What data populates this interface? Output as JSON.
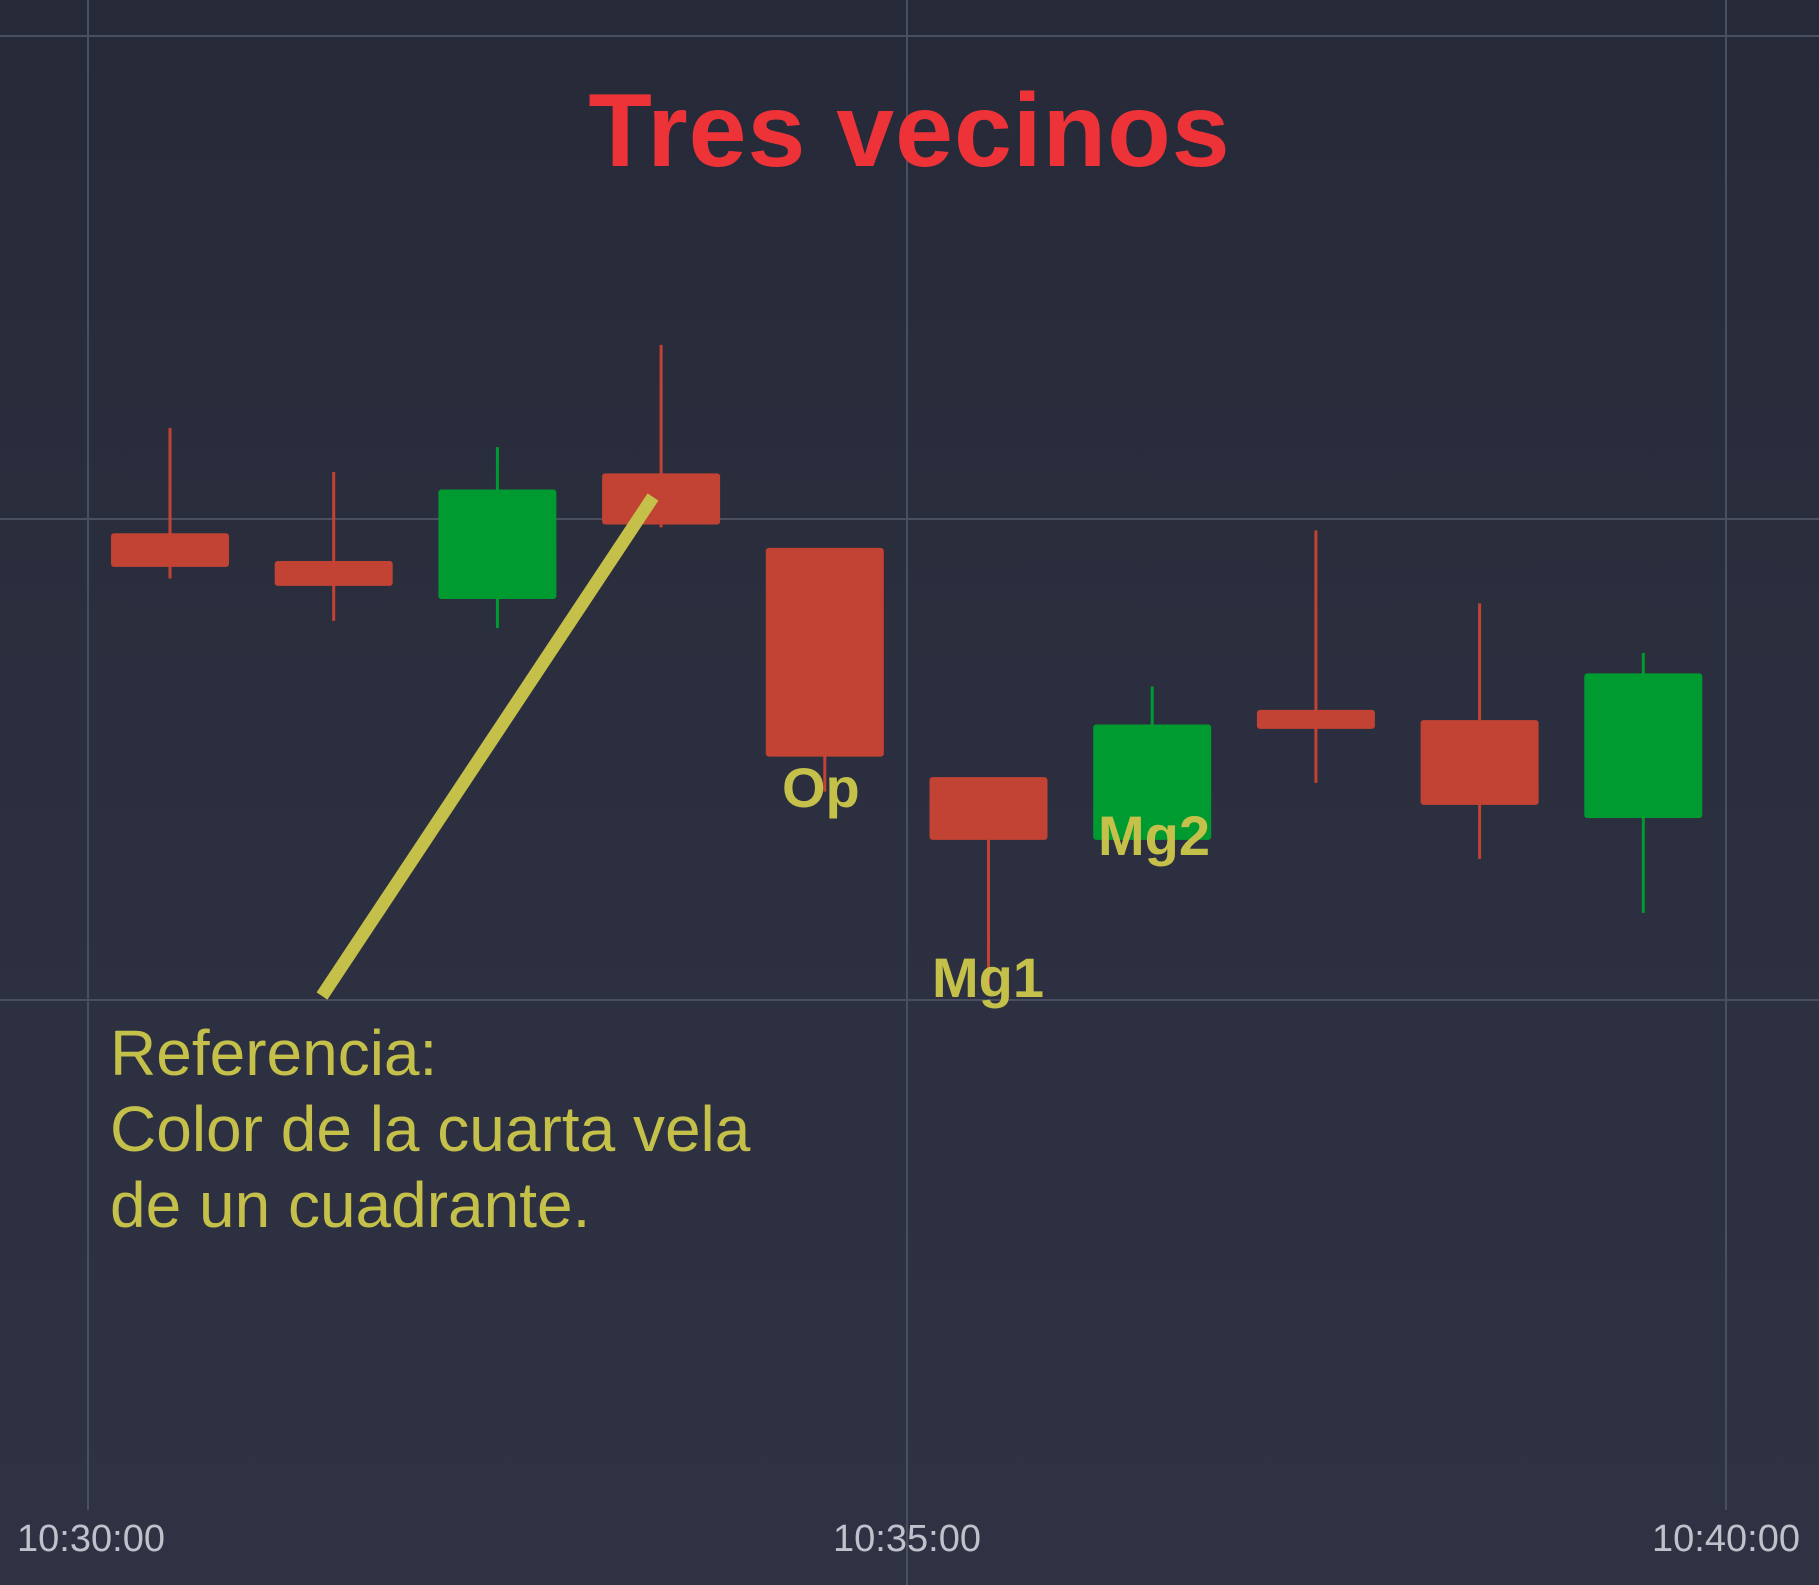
{
  "title": "Tres vecinos",
  "colors": {
    "background": "#2a2e3d",
    "grid": "#4a4f5f",
    "bearish": "#c24333",
    "bullish": "#009b30",
    "title": "#ee3338",
    "annotation": "#c4c049",
    "axis_text": "#bfc2cb"
  },
  "labels": {
    "op": "Op",
    "mg1": "Mg1",
    "mg2": "Mg2",
    "reference_line1": "Referencia:",
    "reference_line2": "Color de la cuarta vela",
    "reference_line3": "de un cuadrante."
  },
  "chart_data": {
    "type": "candlestick",
    "x_tick_labels": [
      "10:30:00",
      "10:35:00",
      "10:40:00"
    ],
    "grid": true,
    "y_range": [
      0,
      100
    ],
    "candles": [
      {
        "open": 66.9,
        "close": 64.6,
        "high": 74.1,
        "low": 63.8
      },
      {
        "open": 65.0,
        "close": 63.3,
        "high": 71.1,
        "low": 60.9
      },
      {
        "open": 62.4,
        "close": 69.9,
        "high": 72.8,
        "low": 60.4
      },
      {
        "open": 71.0,
        "close": 67.5,
        "high": 79.8,
        "low": 67.3
      },
      {
        "open": 65.9,
        "close": 51.6,
        "high": 65.9,
        "low": 49.2
      },
      {
        "open": 50.2,
        "close": 45.9,
        "high": 50.2,
        "low": 35.3
      },
      {
        "open": 45.9,
        "close": 53.8,
        "high": 56.4,
        "low": 45.4
      },
      {
        "open": 54.8,
        "close": 53.5,
        "high": 67.1,
        "low": 49.8
      },
      {
        "open": 54.1,
        "close": 48.3,
        "high": 62.1,
        "low": 44.6
      },
      {
        "open": 47.4,
        "close": 57.3,
        "high": 58.7,
        "low": 40.9
      }
    ]
  }
}
